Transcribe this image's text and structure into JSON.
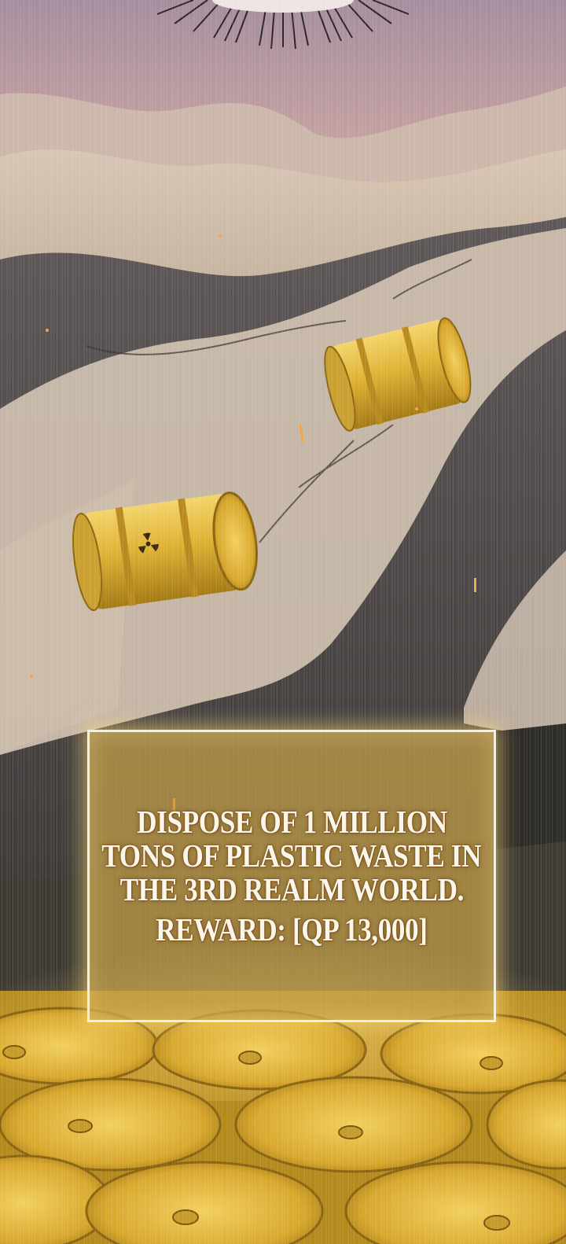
{
  "quest": {
    "line1": "DISPOSE OF 1 MILLION",
    "line2": "TONS OF PLASTIC WASTE IN",
    "line3": "THE 3RD REALM WORLD.",
    "reward": "REWARD: [QP 13,000]"
  },
  "colors": {
    "sky": "#c9a6a2",
    "dune": "#cdbba7",
    "rock": "#4a4644",
    "barrel_gold": "#e2b53c",
    "panel_fill": "#c4a048",
    "panel_border": "#f6efdc"
  },
  "icons": {
    "radiation": "radiation-icon",
    "sunburst": "sunburst-icon"
  }
}
